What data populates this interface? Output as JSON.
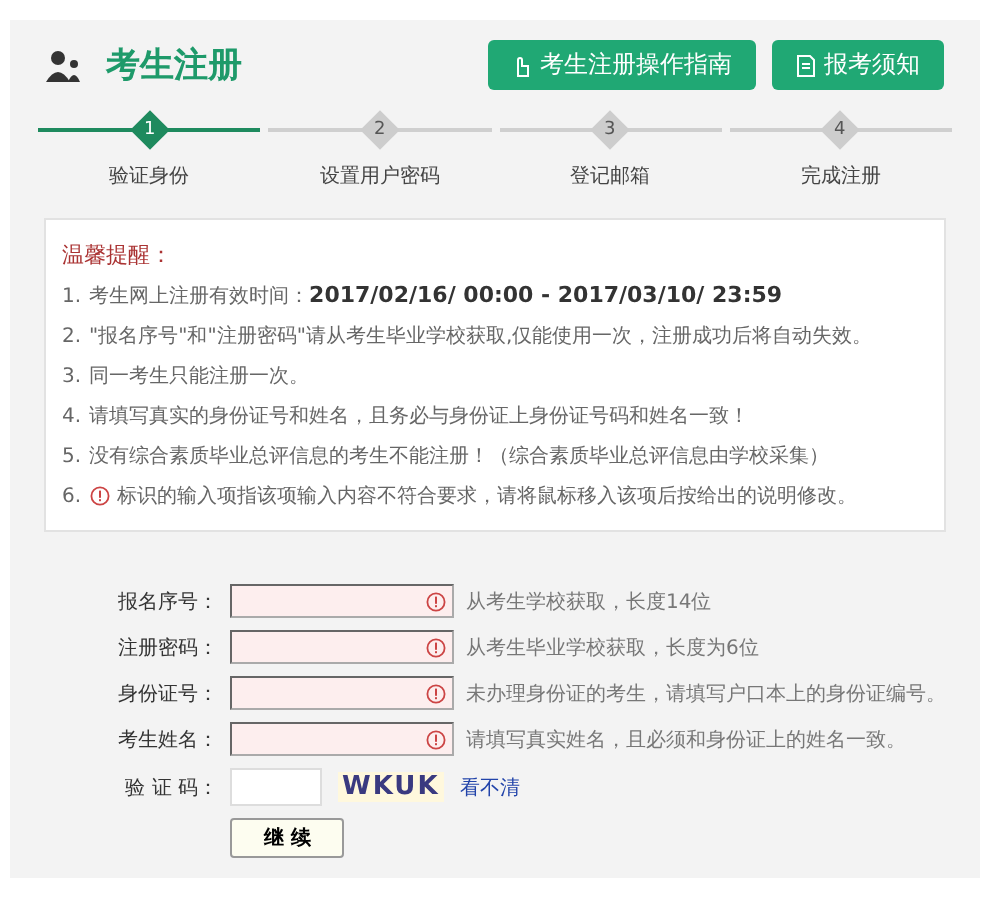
{
  "header": {
    "title": "考生注册",
    "buttons": [
      {
        "label": "考生注册操作指南"
      },
      {
        "label": "报考须知"
      }
    ]
  },
  "steps": [
    {
      "number": "1",
      "label": "验证身份",
      "selected": true
    },
    {
      "number": "2",
      "label": "设置用户密码",
      "selected": false
    },
    {
      "number": "3",
      "label": "登记邮箱",
      "selected": false
    },
    {
      "number": "4",
      "label": "完成注册",
      "selected": false
    }
  ],
  "notice": {
    "title": "温馨提醒：",
    "items": [
      {
        "number": "1.",
        "text": "考生网上注册有效时间：**2017/02/16/ 00:00 - 2017/03/10/ 23:59**",
        "kind": "plain"
      },
      {
        "number": "2.",
        "text": "\"报名序号\"和\"注册密码\"请从考生毕业学校获取,仅能使用一次，注册成功后将自动失效。",
        "kind": "plain"
      },
      {
        "number": "3.",
        "text": "同一考生只能注册一次。",
        "kind": "plain"
      },
      {
        "number": "4.",
        "text": "请填写真实的身份证号和姓名，且务必与身份证上身份证号码和姓名一致！",
        "kind": "plain"
      },
      {
        "number": "5.",
        "text": "没有综合素质毕业总评信息的考生不能注册！（综合素质毕业总评信息由学校采集）",
        "kind": "plain"
      },
      {
        "number": "6.",
        "text": "标识的输入项指该项输入内容不符合要求，请将鼠标移入该项后按给出的说明修改。",
        "kind": "warning"
      }
    ]
  },
  "form": {
    "fields": [
      {
        "kind": "text",
        "label": "报名序号：",
        "invalid": true,
        "hint": "从考生学校获取，长度14位"
      },
      {
        "kind": "text",
        "label": "注册密码：",
        "invalid": true,
        "hint": "从考生毕业学校获取，长度为6位"
      },
      {
        "kind": "text",
        "label": "身份证号：",
        "invalid": true,
        "hint": "未办理身份证的考生，请填写户口本上的身份证编号。"
      },
      {
        "kind": "text",
        "label": "考生姓名：",
        "invalid": true,
        "hint": "请填写真实姓名，且必须和身份证上的姓名一致。"
      },
      {
        "kind": "captcha",
        "label": "验 证 码：",
        "invalid": false,
        "captcha": "WKUK",
        "refresh": "看不清"
      }
    ],
    "submit": "继 续"
  }
}
